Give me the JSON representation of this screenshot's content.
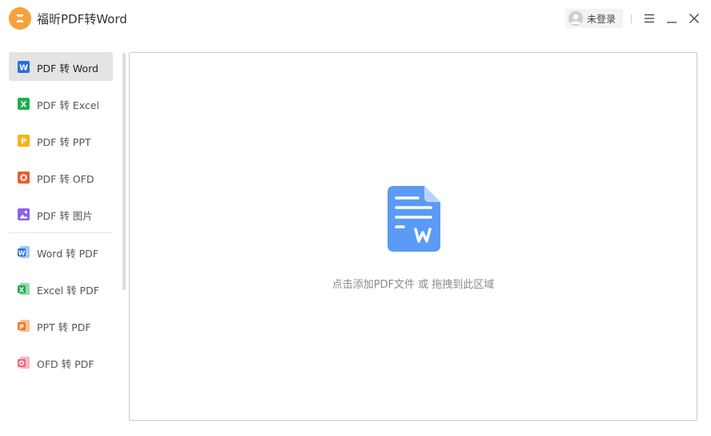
{
  "app": {
    "title": "福昕PDF转Word",
    "logo_icon": "foxit-logo-icon",
    "accent": "#f5a23b"
  },
  "user": {
    "login_label": "未登录",
    "avatar_icon": "user-avatar-icon"
  },
  "window_controls": [
    "menu-icon",
    "minimize-icon",
    "close-icon"
  ],
  "sidebar": {
    "items": [
      {
        "label": "PDF 转 Word",
        "icon": "word-icon",
        "color": "#2b6de5",
        "letter": "W",
        "active": true
      },
      {
        "label": "PDF 转 Excel",
        "icon": "excel-icon",
        "color": "#1fae4f",
        "letter": "X",
        "active": false
      },
      {
        "label": "PDF 转 PPT",
        "icon": "ppt-icon",
        "color": "#f5b31a",
        "letter": "P",
        "active": false
      },
      {
        "label": "PDF 转 OFD",
        "icon": "ofd-icon",
        "color": "#f05a2a",
        "letter": "O",
        "active": false
      },
      {
        "label": "PDF 转 图片",
        "icon": "image-icon",
        "color": "#8a63e8",
        "letter": "",
        "active": false
      },
      {
        "label": "Word 转 PDF",
        "icon": "word-to-pdf-icon",
        "color": "#2b6de5",
        "letter": "W",
        "active": false
      },
      {
        "label": "Excel 转 PDF",
        "icon": "excel-to-pdf-icon",
        "color": "#1fae4f",
        "letter": "X",
        "active": false
      },
      {
        "label": "PPT 转 PDF",
        "icon": "ppt-to-pdf-icon",
        "color": "#f07a2a",
        "letter": "P",
        "active": false
      },
      {
        "label": "OFD 转 PDF",
        "icon": "ofd-to-pdf-icon",
        "color": "#f06a7a",
        "letter": "O",
        "active": false
      }
    ]
  },
  "dropzone": {
    "hint": "点击添加PDF文件 或 拖拽到此区域",
    "icon": "word-document-icon",
    "icon_color": "#5b9bf5"
  }
}
